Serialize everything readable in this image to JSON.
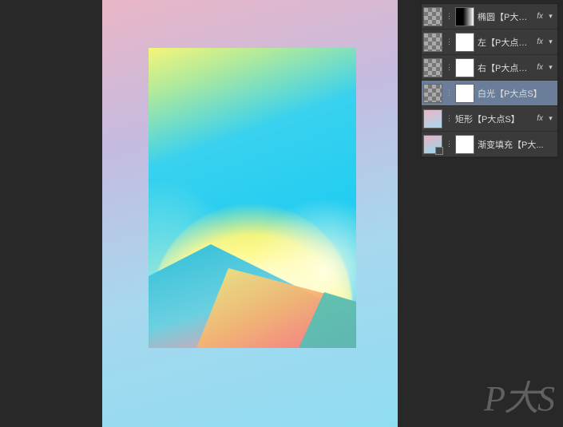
{
  "layers": {
    "items": [
      {
        "name": "椭圆【P大点S...",
        "fx": "fx",
        "thumb1": "checker",
        "thumb2": "blackgrad",
        "selected": false
      },
      {
        "name": "左【P大点S】",
        "fx": "fx",
        "thumb1": "checker",
        "thumb2": "white",
        "selected": false
      },
      {
        "name": "右【P大点S】",
        "fx": "fx",
        "thumb1": "checker",
        "thumb2": "white",
        "selected": false
      },
      {
        "name": "白光【P大点S】",
        "fx": "",
        "thumb1": "checker",
        "thumb2": "white",
        "selected": true
      },
      {
        "name": "矩形【P大点S】",
        "fx": "fx",
        "thumb1": "pinkrect",
        "thumb2": "",
        "selected": false
      },
      {
        "name": "渐变填充【P大...",
        "fx": "",
        "thumb1": "gradfill",
        "thumb2": "white",
        "selected": false,
        "adjustment": true
      }
    ]
  },
  "watermark": "P大S"
}
